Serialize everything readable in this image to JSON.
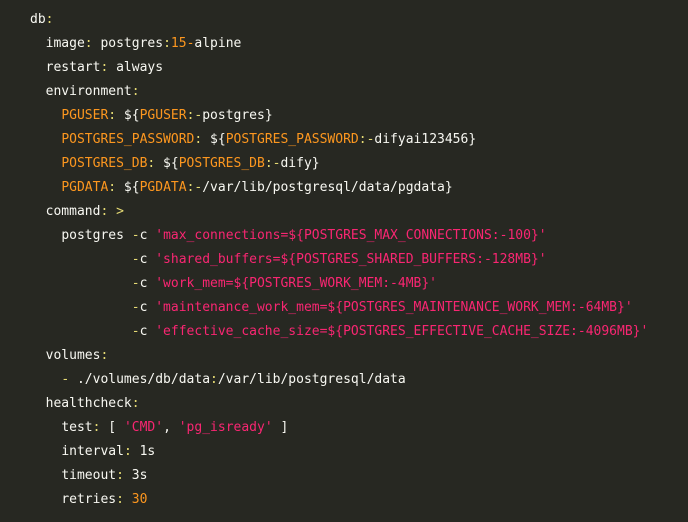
{
  "colors": {
    "background": "#272822",
    "plain": "#f8f8f2",
    "key": "#e6db74",
    "keyword": "#fd971f",
    "string": "#f92672",
    "number": "#ae81ff",
    "punct": "#f8f8f2"
  },
  "lines": [
    {
      "indent": "",
      "tokens": [
        {
          "text": "db",
          "type": "plain"
        },
        {
          "text": ":",
          "type": "key"
        }
      ]
    },
    {
      "indent": "  ",
      "tokens": [
        {
          "text": "image",
          "type": "plain"
        },
        {
          "text": ":",
          "type": "key"
        },
        {
          "text": " postgres",
          "type": "plain"
        },
        {
          "text": ":",
          "type": "key"
        },
        {
          "text": "15",
          "type": "keyword"
        },
        {
          "text": "-",
          "type": "keyword"
        },
        {
          "text": "alpine",
          "type": "plain"
        }
      ]
    },
    {
      "indent": "  ",
      "tokens": [
        {
          "text": "restart",
          "type": "plain"
        },
        {
          "text": ":",
          "type": "key"
        },
        {
          "text": " always",
          "type": "plain"
        }
      ]
    },
    {
      "indent": "  ",
      "tokens": [
        {
          "text": "environment",
          "type": "plain"
        },
        {
          "text": ":",
          "type": "key"
        }
      ]
    },
    {
      "indent": "    ",
      "tokens": [
        {
          "text": "PGUSER",
          "type": "keyword"
        },
        {
          "text": ":",
          "type": "key"
        },
        {
          "text": " ${",
          "type": "plain"
        },
        {
          "text": "PGUSER",
          "type": "keyword"
        },
        {
          "text": ":-",
          "type": "key"
        },
        {
          "text": "postgres}",
          "type": "plain"
        }
      ]
    },
    {
      "indent": "    ",
      "tokens": [
        {
          "text": "POSTGRES_PASSWORD",
          "type": "keyword"
        },
        {
          "text": ":",
          "type": "key"
        },
        {
          "text": " ${",
          "type": "plain"
        },
        {
          "text": "POSTGRES_PASSWORD",
          "type": "keyword"
        },
        {
          "text": ":-",
          "type": "key"
        },
        {
          "text": "difyai123456}",
          "type": "plain"
        }
      ]
    },
    {
      "indent": "    ",
      "tokens": [
        {
          "text": "POSTGRES_DB",
          "type": "keyword"
        },
        {
          "text": ":",
          "type": "key"
        },
        {
          "text": " ${",
          "type": "plain"
        },
        {
          "text": "POSTGRES_DB",
          "type": "keyword"
        },
        {
          "text": ":-",
          "type": "key"
        },
        {
          "text": "dify}",
          "type": "plain"
        }
      ]
    },
    {
      "indent": "    ",
      "tokens": [
        {
          "text": "PGDATA",
          "type": "keyword"
        },
        {
          "text": ":",
          "type": "key"
        },
        {
          "text": " ${",
          "type": "plain"
        },
        {
          "text": "PGDATA",
          "type": "keyword"
        },
        {
          "text": ":-",
          "type": "key"
        },
        {
          "text": "/var/lib/postgresql/data/pgdata}",
          "type": "plain"
        }
      ]
    },
    {
      "indent": "  ",
      "tokens": [
        {
          "text": "command",
          "type": "plain"
        },
        {
          "text": ":",
          "type": "key"
        },
        {
          "text": " >",
          "type": "key"
        }
      ]
    },
    {
      "indent": "    ",
      "tokens": [
        {
          "text": "postgres ",
          "type": "plain"
        },
        {
          "text": "-",
          "type": "key"
        },
        {
          "text": "c ",
          "type": "plain"
        },
        {
          "text": "'max_connections=${POSTGRES_MAX_CONNECTIONS:-100}'",
          "type": "string"
        }
      ]
    },
    {
      "indent": "             ",
      "tokens": [
        {
          "text": "-",
          "type": "key"
        },
        {
          "text": "c ",
          "type": "plain"
        },
        {
          "text": "'shared_buffers=${POSTGRES_SHARED_BUFFERS:-128MB}'",
          "type": "string"
        }
      ]
    },
    {
      "indent": "             ",
      "tokens": [
        {
          "text": "-",
          "type": "key"
        },
        {
          "text": "c ",
          "type": "plain"
        },
        {
          "text": "'work_mem=${POSTGRES_WORK_MEM:-4MB}'",
          "type": "string"
        }
      ]
    },
    {
      "indent": "             ",
      "tokens": [
        {
          "text": "-",
          "type": "key"
        },
        {
          "text": "c ",
          "type": "plain"
        },
        {
          "text": "'maintenance_work_mem=${POSTGRES_MAINTENANCE_WORK_MEM:-64MB}'",
          "type": "string"
        }
      ]
    },
    {
      "indent": "             ",
      "tokens": [
        {
          "text": "-",
          "type": "key"
        },
        {
          "text": "c ",
          "type": "plain"
        },
        {
          "text": "'effective_cache_size=${POSTGRES_EFFECTIVE_CACHE_SIZE:-4096MB}'",
          "type": "string"
        }
      ]
    },
    {
      "indent": "  ",
      "tokens": [
        {
          "text": "volumes",
          "type": "plain"
        },
        {
          "text": ":",
          "type": "key"
        }
      ]
    },
    {
      "indent": "    ",
      "tokens": [
        {
          "text": "- ",
          "type": "key"
        },
        {
          "text": "./volumes/db/data",
          "type": "plain"
        },
        {
          "text": ":",
          "type": "key"
        },
        {
          "text": "/var/lib/postgresql/data",
          "type": "plain"
        }
      ]
    },
    {
      "indent": "  ",
      "tokens": [
        {
          "text": "healthcheck",
          "type": "plain"
        },
        {
          "text": ":",
          "type": "key"
        }
      ]
    },
    {
      "indent": "    ",
      "tokens": [
        {
          "text": "test",
          "type": "plain"
        },
        {
          "text": ":",
          "type": "key"
        },
        {
          "text": " [ ",
          "type": "plain"
        },
        {
          "text": "'CMD'",
          "type": "string"
        },
        {
          "text": ", ",
          "type": "plain"
        },
        {
          "text": "'pg_isready'",
          "type": "string"
        },
        {
          "text": " ]",
          "type": "plain"
        }
      ]
    },
    {
      "indent": "    ",
      "tokens": [
        {
          "text": "interval",
          "type": "plain"
        },
        {
          "text": ":",
          "type": "key"
        },
        {
          "text": " 1s",
          "type": "plain"
        }
      ]
    },
    {
      "indent": "    ",
      "tokens": [
        {
          "text": "timeout",
          "type": "plain"
        },
        {
          "text": ":",
          "type": "key"
        },
        {
          "text": " 3s",
          "type": "plain"
        }
      ]
    },
    {
      "indent": "    ",
      "tokens": [
        {
          "text": "retries",
          "type": "plain"
        },
        {
          "text": ":",
          "type": "key"
        },
        {
          "text": " ",
          "type": "plain"
        },
        {
          "text": "30",
          "type": "keyword"
        }
      ]
    }
  ]
}
